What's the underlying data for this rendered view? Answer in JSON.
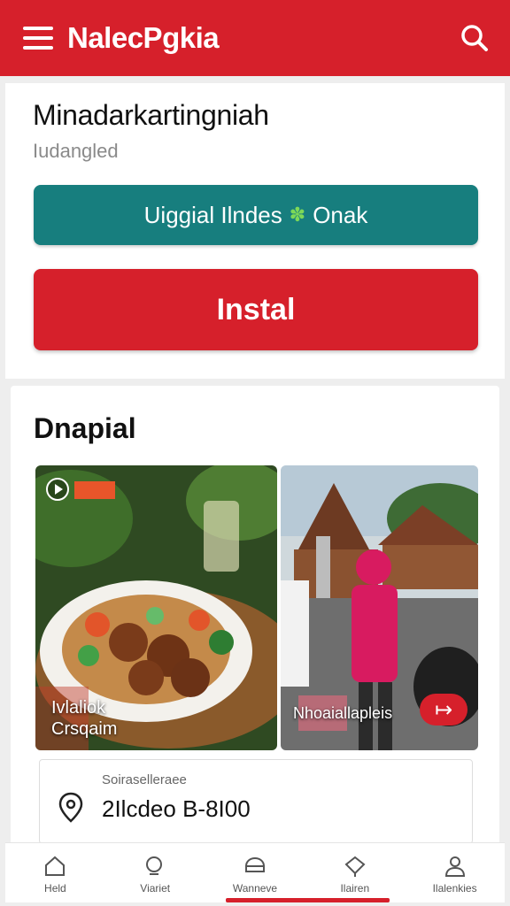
{
  "app_bar": {
    "title": "NalecPgkia",
    "menu_icon": "hamburger-menu-icon",
    "search_icon": "search-icon",
    "color": "#d6202b"
  },
  "header_card": {
    "title": "Minadarkartingniah",
    "subtitle": "Iudangled",
    "teal_button": {
      "label_left": "Uiggial Ilndes",
      "leaf_icon": "✽",
      "label_right": "Onak",
      "color": "#177e7e"
    },
    "install_button": {
      "label": "Instal",
      "color": "#d6202b"
    }
  },
  "section": {
    "title": "Dnapial",
    "tiles": [
      {
        "caption_line1": "Ivlaliok",
        "caption_line2": "Crsqaim",
        "image": "food-plate-photo"
      },
      {
        "caption": "Nhoaiallapleis",
        "image": "temple-street-photo",
        "action_icon": "arrow-right-icon"
      }
    ],
    "info": {
      "label": "Soiraselleraee",
      "value": "2Ilcdeo B-8I00",
      "icon": "location-pin-icon"
    }
  },
  "bottom_nav": [
    {
      "label": "Held",
      "icon": "home-icon"
    },
    {
      "label": "Viariet",
      "icon": "search-icon"
    },
    {
      "label": "Wanneve",
      "icon": "bag-icon",
      "active": true
    },
    {
      "label": "Ilairen",
      "icon": "chat-icon"
    },
    {
      "label": "Ilalenkies",
      "icon": "profile-icon"
    }
  ]
}
